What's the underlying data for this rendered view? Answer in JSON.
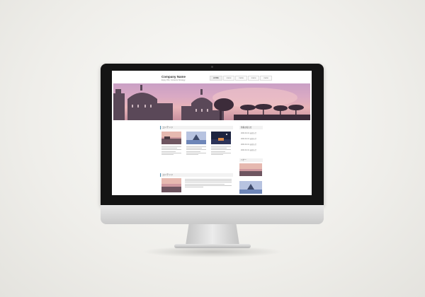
{
  "site": {
    "name": "Company Name",
    "tagline": "Enjoy ISS, Contents Strategy"
  },
  "nav": [
    "HOME",
    "menu",
    "menu",
    "menu",
    "menu"
  ],
  "sections": {
    "first_title": "コンテンツ",
    "second_title": "コンテンツ"
  },
  "sidebar": {
    "title": "新着お知らせ",
    "links": [
      "2024.01.01 お知らせ",
      "2024.01.01 お知らせ",
      "2024.01.01 お知らせ",
      "2024.01.01 お知らせ"
    ],
    "banner_title": "バナー"
  },
  "colors": {
    "accent": "#4a8fb3",
    "hero_sky": "#d9a9c4"
  },
  "icons": [
    "camera-dot"
  ]
}
